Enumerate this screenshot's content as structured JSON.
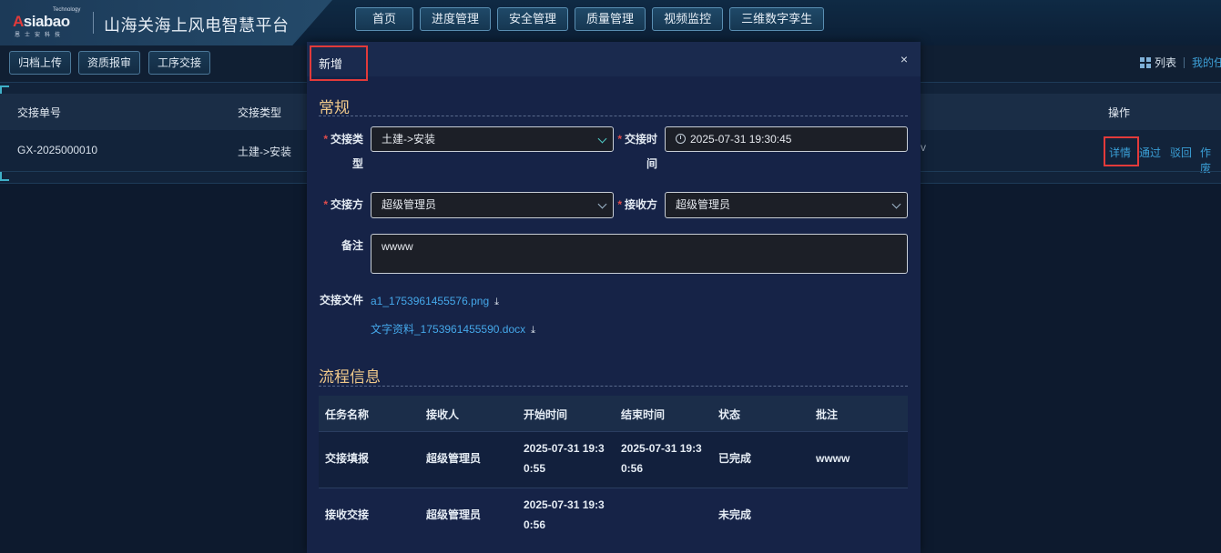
{
  "brand": {
    "logo_text_a": "A",
    "logo_text_rest": "siabao",
    "logo_tech": "Technology",
    "logo_sub": "恩士安科技",
    "app_title": "山海关海上风电智慧平台"
  },
  "nav": {
    "items": [
      {
        "label": "首页"
      },
      {
        "label": "进度管理"
      },
      {
        "label": "安全管理"
      },
      {
        "label": "质量管理"
      },
      {
        "label": "视频监控"
      },
      {
        "label": "三维数字孪生"
      }
    ]
  },
  "toolbar": {
    "archive_upload": "归档上传",
    "qualification_review": "资质报审",
    "process_handover": "工序交接",
    "list_label": "列表",
    "my_tasks_label": "我的任"
  },
  "list": {
    "headers": {
      "handover_no": "交接单号",
      "handover_type": "交接类型",
      "operation": "操作"
    },
    "rows": [
      {
        "handover_no": "GX-2025000010",
        "handover_type": "土建->安装",
        "truncated_col": "v",
        "ops": {
          "detail": "详情",
          "approve": "通过",
          "reject": "驳回",
          "void": "作废"
        }
      }
    ]
  },
  "modal": {
    "title": "新增",
    "close_glyph": "×",
    "section_general": "常规",
    "fields": {
      "handover_type_label_1": "交接类",
      "handover_type_label_2": "型",
      "handover_type_value": "土建->安装",
      "handover_time_label_1": "交接时",
      "handover_time_label_2": "间",
      "handover_time_value": "2025-07-31 19:30:45",
      "handover_party_label": "交接方",
      "handover_party_value": "超级管理员",
      "receiver_label": "接收方",
      "receiver_value": "超级管理员",
      "remark_label": "备注",
      "remark_value": "wwww",
      "files_label": "交接文件",
      "files": [
        {
          "name": "a1_1753961455576.png"
        },
        {
          "name": "文字资料_1753961455590.docx"
        }
      ],
      "required_mark": "*",
      "download_glyph": "⤓"
    },
    "section_flow": "流程信息",
    "flow_table": {
      "headers": [
        "任务名称",
        "接收人",
        "开始时间",
        "结束时间",
        "状态",
        "批注"
      ],
      "rows": [
        {
          "task": "交接填报",
          "receiver": "超级管理员",
          "start_1": "2025-07-31 19:3",
          "start_2": "0:55",
          "end_1": "2025-07-31 19:3",
          "end_2": "0:56",
          "status": "已完成",
          "note": "wwww"
        },
        {
          "task": "接收交接",
          "receiver": "超级管理员",
          "start_1": "2025-07-31 19:3",
          "start_2": "0:56",
          "end_1": "",
          "end_2": "",
          "status": "未完成",
          "note": ""
        }
      ]
    }
  },
  "colors": {
    "accent_gold": "#f0c98a",
    "link_blue": "#3a9fd6",
    "highlight_red": "#e23a3a",
    "required_red": "#e14c4c"
  }
}
